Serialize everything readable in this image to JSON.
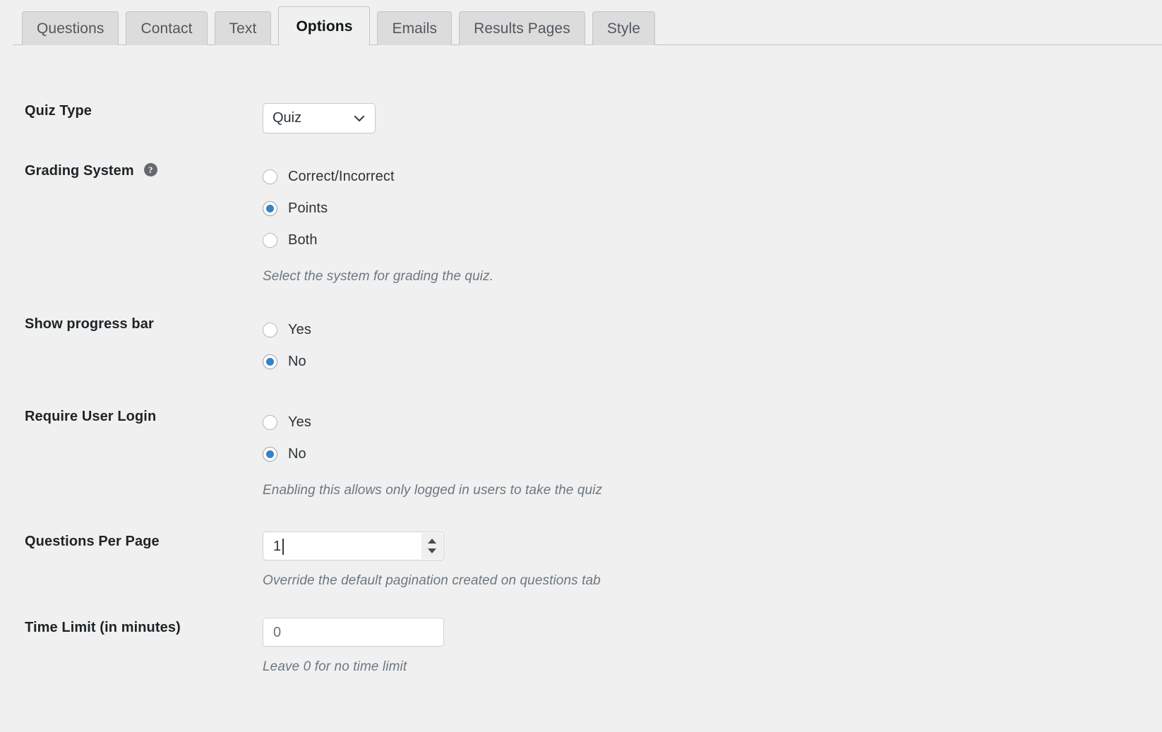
{
  "tabs": [
    {
      "label": "Questions",
      "active": false
    },
    {
      "label": "Contact",
      "active": false
    },
    {
      "label": "Text",
      "active": false
    },
    {
      "label": "Options",
      "active": true
    },
    {
      "label": "Emails",
      "active": false
    },
    {
      "label": "Results Pages",
      "active": false
    },
    {
      "label": "Style",
      "active": false
    }
  ],
  "colors": {
    "page_background": "#f0f0f0",
    "tab_inactive_background": "#dcdcdc",
    "tab_active_background": "#f0f0f0",
    "tab_border": "#c3c4c7",
    "radio_accent": "#3582c4",
    "help_icon_background": "#646970",
    "hint_text": "#6c7781",
    "label_text": "#1d2327"
  },
  "fields": {
    "quiz_type": {
      "label": "Quiz Type",
      "selected": "Quiz",
      "options": [
        "Quiz"
      ],
      "icon": "chevron-down-icon"
    },
    "grading_system": {
      "label": "Grading System",
      "help_icon": "question-mark-help-icon",
      "options": [
        {
          "label": "Correct/Incorrect",
          "checked": false
        },
        {
          "label": "Points",
          "checked": true
        },
        {
          "label": "Both",
          "checked": false
        }
      ],
      "hint": "Select the system for grading the quiz."
    },
    "show_progress_bar": {
      "label": "Show progress bar",
      "options": [
        {
          "label": "Yes",
          "checked": false
        },
        {
          "label": "No",
          "checked": true
        }
      ]
    },
    "require_user_login": {
      "label": "Require User Login",
      "options": [
        {
          "label": "Yes",
          "checked": false
        },
        {
          "label": "No",
          "checked": true
        }
      ],
      "hint": "Enabling this allows only logged in users to take the quiz"
    },
    "questions_per_page": {
      "label": "Questions Per Page",
      "value": "1",
      "focused": true,
      "hint": "Override the default pagination created on questions tab",
      "spinner_up_icon": "triangle-up-icon",
      "spinner_down_icon": "triangle-down-icon"
    },
    "time_limit": {
      "label": "Time Limit (in minutes)",
      "value": "0",
      "hint": "Leave 0 for no time limit"
    }
  }
}
